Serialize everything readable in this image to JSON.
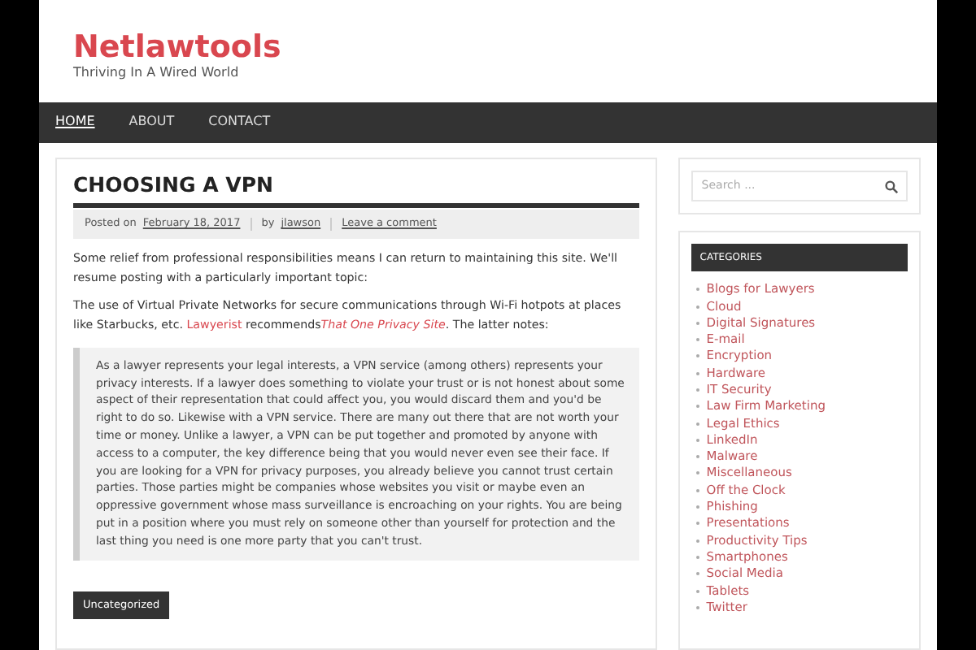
{
  "site": {
    "title": "Netlawtools",
    "tagline": "Thriving In A Wired World"
  },
  "nav": [
    {
      "label": "HOME",
      "selected": true
    },
    {
      "label": "ABOUT",
      "selected": false
    },
    {
      "label": "CONTACT",
      "selected": false
    }
  ],
  "post": {
    "title": "CHOOSING A VPN",
    "meta": {
      "posted_on": "Posted on",
      "date": "February 18, 2017",
      "by": "by",
      "author": "jlawson",
      "comments": "Leave a comment"
    },
    "paragraphs": [
      [
        {
          "text": "Some relief from professional responsibilities means I can return to maintaining this site. We'll resume posting with a particularly important topic:"
        }
      ],
      [
        {
          "text": "The use of Virtual Private Networks for secure communications through Wi-Fi hotpots at places like Starbucks, etc. "
        },
        {
          "text": "Lawyerist",
          "kind": "link"
        },
        {
          "text": " recommends"
        },
        {
          "text": "That One Privacy Site",
          "kind": "italic-link"
        },
        {
          "text": ". The latter notes:"
        }
      ]
    ],
    "quote": "As a lawyer represents your legal interests, a VPN service (among others) represents your privacy interests. If a lawyer does something to violate your trust or is not honest about some aspect of their representation that could affect you, you would discard them and you'd be right to do so. Likewise with a VPN service. There are many out there that are not worth your time or money. Unlike a lawyer, a VPN can be put together and promoted by anyone with access to a computer, the key difference being that you would never even see their face. If you are looking for a VPN for privacy purposes, you already believe you cannot trust certain parties. Those parties might be companies whose websites you visit or maybe even an oppressive government whose mass surveillance is encroaching on your rights. You are being put in a position where you must rely on someone other than yourself for protection and the last thing you need is one more party that you can't trust.",
    "category": "Uncategorized"
  },
  "search": {
    "placeholder": "Search ..."
  },
  "categories": {
    "title": "CATEGORIES",
    "items": [
      "Blogs for Lawyers",
      "Cloud",
      "Digital Signatures",
      "E-mail",
      "Encryption",
      "Hardware",
      "IT Security",
      "Law Firm Marketing",
      "Legal Ethics",
      "LinkedIn",
      "Malware",
      "Miscellaneous",
      "Off the Clock",
      "Phishing",
      "Presentations",
      "Productivity Tips",
      "Smartphones",
      "Social Media",
      "Tablets",
      "Twitter"
    ]
  }
}
